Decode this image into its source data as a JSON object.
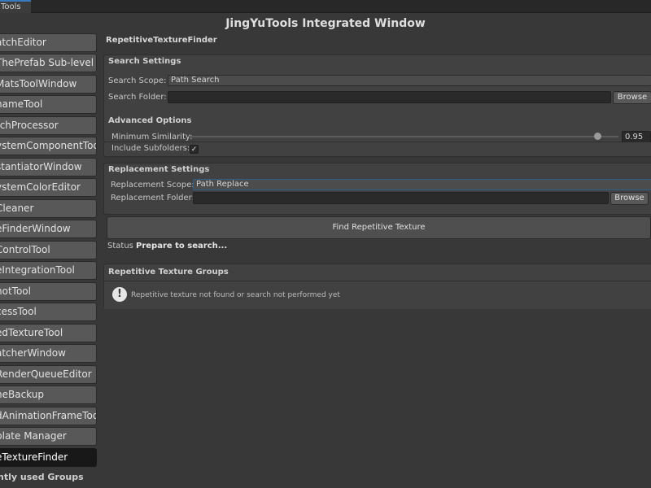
{
  "tab": {
    "label": "Tools"
  },
  "window": {
    "title": "JingYuTools Integrated Window"
  },
  "sidebar": {
    "items": [
      {
        "label": "atchEditor"
      },
      {
        "label": "ThePrefab Sub-level"
      },
      {
        "label": "MatsToolWindow"
      },
      {
        "label": "nameTool"
      },
      {
        "label": "tchProcessor"
      },
      {
        "label": "ystemComponentTool"
      },
      {
        "label": "stantiatorWindow"
      },
      {
        "label": "ystemColorEditor"
      },
      {
        "label": "Cleaner"
      },
      {
        "label": "eFinderWindow"
      },
      {
        "label": "ControlTool"
      },
      {
        "label": "eIntegrationTool"
      },
      {
        "label": "notTool"
      },
      {
        "label": "cessTool"
      },
      {
        "label": "edTextureTool"
      },
      {
        "label": "atcherWindow"
      },
      {
        "label": "RenderQueueEditor"
      },
      {
        "label": "neBackup"
      },
      {
        "label": "dAnimationFrameTool"
      },
      {
        "label": "plate Manager"
      },
      {
        "label": "eTextureFinder"
      }
    ],
    "footer": "ntly used Groups"
  },
  "tool": {
    "title": "RepetitiveTextureFinder",
    "search": {
      "header": "Search Settings",
      "scope_label": "Search Scope:",
      "scope_value": "Path Search",
      "folder_label": "Search Folder:",
      "folder_value": "",
      "browse_label": "Browse"
    },
    "advanced": {
      "header": "Advanced Options",
      "similarity_label": "Minimum Similarity:",
      "similarity_value": "0.95",
      "similarity_fraction": 0.95,
      "subfolders_label": "Include Subfolders:",
      "subfolders_checked": true,
      "check_glyph": "✓"
    },
    "replacement": {
      "header": "Replacement Settings",
      "scope_label": "Replacement Scope:",
      "scope_value": "Path Replace",
      "folder_label": "Replacement Folder:",
      "folder_value": "",
      "browse_label": "Browse"
    },
    "find_button": "Find Repetitive Texture",
    "status": {
      "label": "Status",
      "value": "Prepare to search..."
    },
    "groups": {
      "header": "Repetitive Texture Groups",
      "icon_glyph": "!",
      "message": "Repetitive texture not found or search not performed yet"
    }
  },
  "colors": {
    "accent": "#3a79bb",
    "active_item": "#181818",
    "panel_bg": "#414141",
    "window_bg": "#383838"
  }
}
